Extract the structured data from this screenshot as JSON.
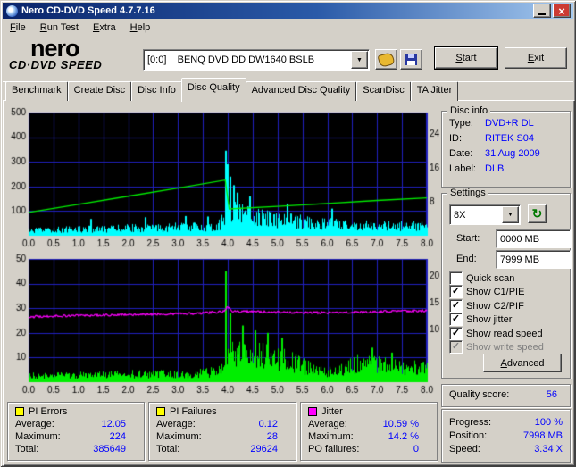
{
  "window": {
    "title": "Nero CD-DVD Speed 4.7.7.16"
  },
  "menu": {
    "items": [
      "File",
      "Run Test",
      "Extra",
      "Help"
    ]
  },
  "header": {
    "logo_line1": "nero",
    "logo_line2": "CD·DVD SPEED",
    "drive_value": "[0:0]    BENQ DVD DD DW1640 BSLB",
    "start_label": "Start",
    "exit_label": "Exit"
  },
  "tabs": {
    "items": [
      "Benchmark",
      "Create Disc",
      "Disc Info",
      "Disc Quality",
      "Advanced Disc Quality",
      "ScanDisc",
      "TA Jitter"
    ],
    "active": "Disc Quality"
  },
  "disc_info": {
    "title": "Disc info",
    "rows": [
      {
        "label": "Type:",
        "value": "DVD+R DL"
      },
      {
        "label": "ID:",
        "value": "RITEK S04"
      },
      {
        "label": "Date:",
        "value": "31 Aug 2009"
      },
      {
        "label": "Label:",
        "value": "DLB"
      }
    ]
  },
  "settings": {
    "title": "Settings",
    "speed_value": "8X",
    "start_label": "Start:",
    "start_value": "0000 MB",
    "end_label": "End:",
    "end_value": "7999 MB",
    "checkboxes": [
      {
        "label": "Quick scan",
        "checked": false,
        "enabled": true
      },
      {
        "label": "Show C1/PIE",
        "checked": true,
        "enabled": true
      },
      {
        "label": "Show C2/PIF",
        "checked": true,
        "enabled": true
      },
      {
        "label": "Show jitter",
        "checked": true,
        "enabled": true
      },
      {
        "label": "Show read speed",
        "checked": true,
        "enabled": true
      },
      {
        "label": "Show write speed",
        "checked": true,
        "enabled": false
      }
    ],
    "advanced_label": "Advanced"
  },
  "quality": {
    "label": "Quality score:",
    "value": "56"
  },
  "progress": {
    "rows": [
      {
        "label": "Progress:",
        "value": "100 %"
      },
      {
        "label": "Position:",
        "value": "7998 MB"
      },
      {
        "label": "Speed:",
        "value": "3.34 X"
      }
    ]
  },
  "stats": [
    {
      "title": "PI Errors",
      "color": "#ffff00",
      "rows": [
        {
          "label": "Average:",
          "value": "12.05"
        },
        {
          "label": "Maximum:",
          "value": "224"
        },
        {
          "label": "Total:",
          "value": "385649"
        }
      ]
    },
    {
      "title": "PI Failures",
      "color": "#ffff00",
      "rows": [
        {
          "label": "Average:",
          "value": "0.12"
        },
        {
          "label": "Maximum:",
          "value": "28"
        },
        {
          "label": "Total:",
          "value": "29624"
        }
      ]
    },
    {
      "title": "Jitter",
      "color": "#ff00ff",
      "rows": [
        {
          "label": "Average:",
          "value": "10.59 %"
        },
        {
          "label": "Maximum:",
          "value": "14.2 %"
        },
        {
          "label": "PO failures:",
          "value": "0"
        }
      ]
    }
  ],
  "chart_data": [
    {
      "type": "area",
      "name": "pi-errors-and-read-speed",
      "grid_color": "#2020c0",
      "x": {
        "min": 0,
        "max": 8,
        "tick_step": 0.5,
        "labels": [
          "0.0",
          "0.5",
          "1.0",
          "1.5",
          "2.0",
          "2.5",
          "3.0",
          "3.5",
          "4.0",
          "4.5",
          "5.0",
          "5.5",
          "6.0",
          "6.5",
          "7.0",
          "7.5",
          "8.0"
        ]
      },
      "left_axis": {
        "min": 0,
        "max": 500,
        "ticks": [
          100,
          200,
          300,
          400,
          500
        ]
      },
      "right_axis": {
        "min": 0,
        "max": 29,
        "ticks": [
          8,
          16,
          24
        ]
      },
      "series": [
        {
          "name": "PI Errors (C1/PIE)",
          "color": "#00ffff",
          "kind": "spiky-area",
          "axis": "left",
          "seed": 12345,
          "envelope": [
            [
              0,
              30
            ],
            [
              0.5,
              38
            ],
            [
              1,
              42
            ],
            [
              1.5,
              40
            ],
            [
              2,
              48
            ],
            [
              2.5,
              46
            ],
            [
              3,
              55
            ],
            [
              3.5,
              54
            ],
            [
              3.8,
              62
            ],
            [
              3.9,
              95
            ],
            [
              3.95,
              150
            ],
            [
              4.0,
              210
            ],
            [
              4.1,
              170
            ],
            [
              4.3,
              140
            ],
            [
              4.6,
              115
            ],
            [
              5,
              95
            ],
            [
              5.5,
              85
            ],
            [
              6,
              75
            ],
            [
              6.5,
              65
            ],
            [
              7,
              60
            ],
            [
              7.5,
              60
            ],
            [
              8,
              62
            ]
          ],
          "spikes": [
            [
              3.96,
              345
            ],
            [
              4.0,
              290
            ],
            [
              4.05,
              240
            ],
            [
              4.12,
              205
            ],
            [
              4.2,
              175
            ],
            [
              4.45,
              160
            ],
            [
              1.25,
              68
            ],
            [
              2.35,
              75
            ],
            [
              3.15,
              80
            ],
            [
              3.6,
              78
            ],
            [
              5.2,
              130
            ],
            [
              6.1,
              110
            ]
          ]
        },
        {
          "name": "Read speed",
          "color": "#00ee00",
          "kind": "line",
          "axis": "right",
          "points": [
            [
              0,
              5.5
            ],
            [
              1,
              7.4
            ],
            [
              2,
              9.3
            ],
            [
              3,
              11.2
            ],
            [
              3.95,
              13.1
            ],
            [
              4.03,
              6.3
            ],
            [
              5,
              6.9
            ],
            [
              6,
              7.6
            ],
            [
              7,
              8.3
            ],
            [
              8,
              8.9
            ]
          ]
        }
      ]
    },
    {
      "type": "area",
      "name": "pi-failures-and-jitter",
      "grid_color": "#2020c0",
      "x": {
        "min": 0,
        "max": 8,
        "tick_step": 0.5,
        "labels": [
          "0.0",
          "0.5",
          "1.0",
          "1.5",
          "2.0",
          "2.5",
          "3.0",
          "3.5",
          "4.0",
          "4.5",
          "5.0",
          "5.5",
          "6.0",
          "6.5",
          "7.0",
          "7.5",
          "8.0"
        ]
      },
      "left_axis": {
        "min": 0,
        "max": 50,
        "ticks": [
          10,
          20,
          30,
          40,
          50
        ]
      },
      "right_axis": {
        "min": 0,
        "max": 23.3,
        "ticks": [
          10,
          15,
          20
        ]
      },
      "series": [
        {
          "name": "PI Failures (C2/PIF)",
          "color": "#00ee00",
          "kind": "spiky-area",
          "axis": "left",
          "seed": 77777,
          "envelope": [
            [
              0,
              4
            ],
            [
              0.5,
              4
            ],
            [
              1,
              4.5
            ],
            [
              1.5,
              4.5
            ],
            [
              2,
              5
            ],
            [
              2.5,
              5
            ],
            [
              3,
              5.5
            ],
            [
              3.5,
              5.5
            ],
            [
              3.85,
              7
            ],
            [
              3.95,
              12
            ],
            [
              4.05,
              18
            ],
            [
              4.3,
              17
            ],
            [
              4.7,
              16
            ],
            [
              5,
              15
            ],
            [
              5.3,
              13
            ],
            [
              5.6,
              9
            ],
            [
              5.9,
              6
            ],
            [
              6.2,
              7
            ],
            [
              6.5,
              11
            ],
            [
              6.8,
              12
            ],
            [
              7.1,
              11
            ],
            [
              7.4,
              10
            ],
            [
              7.7,
              9
            ],
            [
              8,
              9
            ]
          ],
          "spikes": [
            [
              3.97,
              45
            ],
            [
              4.06,
              28
            ],
            [
              4.3,
              23
            ],
            [
              4.55,
              21
            ],
            [
              4.8,
              20
            ],
            [
              5.1,
              18
            ],
            [
              6.9,
              14
            ],
            [
              7.3,
              12
            ]
          ]
        },
        {
          "name": "Jitter",
          "color": "#ff00ff",
          "kind": "noisy-line",
          "axis": "left",
          "seed": 424242,
          "noise": 0.45,
          "points": [
            [
              0,
              26.5
            ],
            [
              0.5,
              26.8
            ],
            [
              1,
              27
            ],
            [
              1.5,
              27.2
            ],
            [
              2,
              27.4
            ],
            [
              2.5,
              27.6
            ],
            [
              3,
              27.8
            ],
            [
              3.5,
              28
            ],
            [
              3.9,
              28.6
            ],
            [
              4,
              30.5
            ],
            [
              4.1,
              28.8
            ],
            [
              4.5,
              28.6
            ],
            [
              5,
              28.4
            ],
            [
              5.5,
              28.2
            ],
            [
              6,
              28.2
            ],
            [
              6.5,
              28.4
            ],
            [
              7,
              28.6
            ],
            [
              7.5,
              28.8
            ],
            [
              8,
              29
            ]
          ]
        }
      ]
    }
  ]
}
